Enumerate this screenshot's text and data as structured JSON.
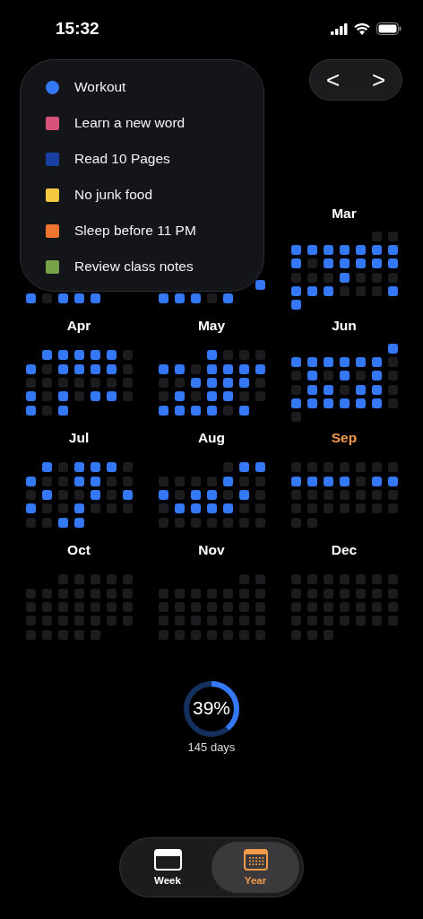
{
  "status_bar": {
    "time": "15:32"
  },
  "habits": [
    {
      "label": "Workout",
      "color": "#3478f6",
      "selected": true
    },
    {
      "label": "Learn a new word",
      "color": "#d6527a",
      "selected": false
    },
    {
      "label": "Read 10 Pages",
      "color": "#1a3fa3",
      "selected": false
    },
    {
      "label": "No junk food",
      "color": "#f5c842",
      "selected": false
    },
    {
      "label": "Sleep before 11 PM",
      "color": "#ef7430",
      "selected": false
    },
    {
      "label": "Review class notes",
      "color": "#78a24a",
      "selected": false
    }
  ],
  "nav": {
    "prev": "<",
    "next": ">"
  },
  "months": [
    {
      "weeks": [
        [
          true,
          false,
          true,
          true,
          true
        ]
      ]
    },
    {
      "weeks": [
        [
          true
        ],
        [
          true,
          true,
          true,
          false,
          true
        ]
      ]
    },
    {
      "name": "Mar",
      "current": false,
      "weeks": [
        [
          false,
          false
        ],
        [
          true,
          true,
          true,
          true,
          true,
          true,
          true
        ],
        [
          true,
          false,
          true,
          true,
          true,
          true,
          true
        ],
        [
          false,
          false,
          false,
          true,
          false,
          false,
          false
        ],
        [
          true,
          true,
          true,
          false,
          false,
          false,
          true
        ],
        [
          true
        ]
      ]
    },
    {
      "name": "Apr",
      "current": false,
      "weeks": [
        [
          true,
          true,
          true,
          true,
          true,
          false
        ],
        [
          true,
          false,
          true,
          true,
          true,
          true,
          false
        ],
        [
          false,
          false,
          false,
          false,
          false,
          false,
          false
        ],
        [
          true,
          false,
          true,
          false,
          true,
          true,
          false
        ],
        [
          true,
          false,
          true
        ]
      ]
    },
    {
      "name": "May",
      "current": false,
      "weeks": [
        [
          true,
          false,
          false,
          false
        ],
        [
          true,
          true,
          false,
          true,
          true,
          true,
          true
        ],
        [
          false,
          false,
          true,
          true,
          true,
          true,
          false
        ],
        [
          false,
          true,
          false,
          true,
          true,
          false,
          false
        ],
        [
          true,
          true,
          true,
          true,
          false,
          true
        ]
      ]
    },
    {
      "name": "Jun",
      "current": false,
      "weeks": [
        [
          true
        ],
        [
          true,
          true,
          true,
          true,
          true,
          true,
          false
        ],
        [
          false,
          true,
          false,
          true,
          false,
          true,
          false
        ],
        [
          false,
          true,
          true,
          false,
          true,
          true,
          false
        ],
        [
          true,
          true,
          true,
          true,
          true,
          true,
          false
        ],
        [
          false
        ]
      ]
    },
    {
      "name": "Jul",
      "current": false,
      "weeks": [
        [
          true,
          false,
          true,
          true,
          true,
          false
        ],
        [
          true,
          false,
          false,
          true,
          true,
          false,
          false
        ],
        [
          false,
          true,
          false,
          false,
          true,
          false,
          true
        ],
        [
          true,
          false,
          false,
          true,
          false,
          false,
          false
        ],
        [
          false,
          false,
          true,
          true
        ]
      ]
    },
    {
      "name": "Aug",
      "current": false,
      "weeks": [
        [
          false,
          true,
          true
        ],
        [
          false,
          false,
          false,
          false,
          true,
          false,
          false
        ],
        [
          true,
          false,
          true,
          true,
          false,
          true,
          false
        ],
        [
          false,
          true,
          true,
          true,
          true,
          false,
          false
        ],
        [
          false,
          false,
          false,
          false,
          false,
          false,
          false
        ]
      ]
    },
    {
      "name": "Sep",
      "current": true,
      "weeks": [
        [
          false,
          false,
          false,
          false,
          false,
          false,
          false
        ],
        [
          true,
          true,
          true,
          true,
          false,
          true,
          true
        ],
        [
          false,
          false,
          false,
          false,
          false,
          false,
          false
        ],
        [
          false,
          false,
          false,
          false,
          false,
          false,
          false
        ],
        [
          false,
          false
        ]
      ]
    },
    {
      "name": "Oct",
      "current": false,
      "weeks": [
        [
          false,
          false,
          false,
          false,
          false
        ],
        [
          false,
          false,
          false,
          false,
          false,
          false,
          false
        ],
        [
          false,
          false,
          false,
          false,
          false,
          false,
          false
        ],
        [
          false,
          false,
          false,
          false,
          false,
          false,
          false
        ],
        [
          false,
          false,
          false,
          false,
          false
        ]
      ]
    },
    {
      "name": "Nov",
      "current": false,
      "weeks": [
        [
          false,
          false
        ],
        [
          false,
          false,
          false,
          false,
          false,
          false,
          false
        ],
        [
          false,
          false,
          false,
          false,
          false,
          false,
          false
        ],
        [
          false,
          false,
          false,
          false,
          false,
          false,
          false
        ],
        [
          false,
          false,
          false,
          false,
          false,
          false,
          false
        ]
      ]
    },
    {
      "name": "Dec",
      "current": false,
      "weeks": [
        [
          false,
          false,
          false,
          false,
          false,
          false,
          false
        ],
        [
          false,
          false,
          false,
          false,
          false,
          false,
          false
        ],
        [
          false,
          false,
          false,
          false,
          false,
          false,
          false
        ],
        [
          false,
          false,
          false,
          false,
          false,
          false,
          false
        ],
        [
          false,
          false,
          false
        ]
      ]
    }
  ],
  "progress": {
    "percent": "39%",
    "level": 0.39,
    "days": "145 days"
  },
  "tabs": [
    {
      "label": "Week",
      "kind": "week",
      "selected": false
    },
    {
      "label": "Year",
      "kind": "year",
      "selected": true
    }
  ]
}
